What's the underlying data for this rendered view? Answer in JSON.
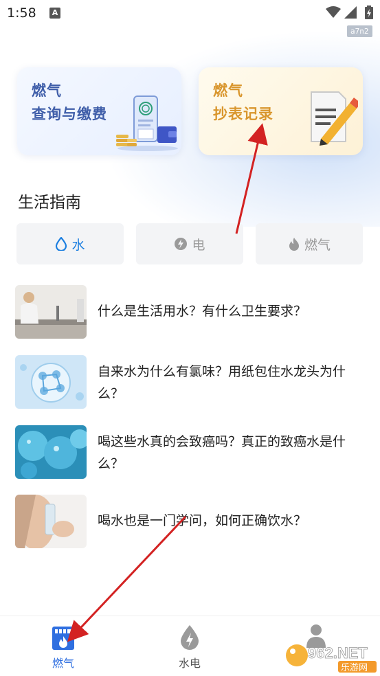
{
  "status": {
    "time": "1:58",
    "notif": "A",
    "build_tag": "a7n2"
  },
  "cards": [
    {
      "line1": "燃气",
      "line2": "查询与缴费"
    },
    {
      "line1": "燃气",
      "line2": "抄表记录"
    }
  ],
  "section_title": "生活指南",
  "tabs": [
    {
      "label": "水",
      "icon": "water-drop-icon"
    },
    {
      "label": "电",
      "icon": "lightning-icon"
    },
    {
      "label": "燃气",
      "icon": "flame-icon"
    }
  ],
  "articles": [
    {
      "title": "什么是生活用水？有什么卫生要求？"
    },
    {
      "title": "自来水为什么有氯味？用纸包住水龙头为什么？"
    },
    {
      "title": "喝这些水真的会致癌吗？真正的致癌水是什么？"
    },
    {
      "title": "喝水也是一门学问，如何正确饮水？"
    }
  ],
  "bottom_nav": [
    {
      "label": "燃气",
      "icon": "gas-meter-icon",
      "active": true
    },
    {
      "label": "水电",
      "icon": "water-drop-icon",
      "active": false
    }
  ],
  "watermark": {
    "text": "962.NET",
    "subtext": "乐游网"
  },
  "colors": {
    "accent": "#2f6fe0",
    "tab_water": "#1c7fe0",
    "card_pay_text": "#3f5ea9",
    "card_read_text": "#d9962d",
    "arrow": "#d32222"
  }
}
